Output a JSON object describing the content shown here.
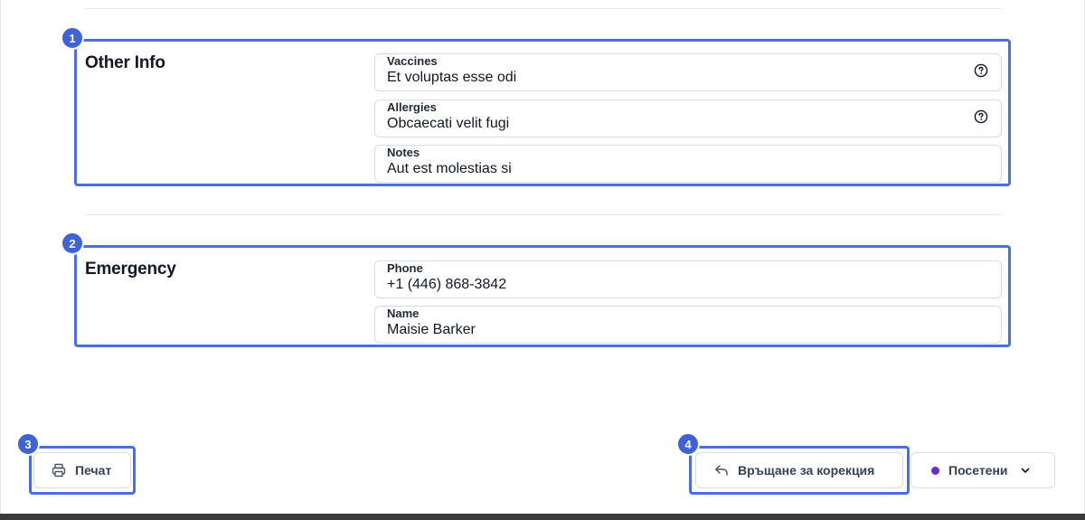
{
  "sections": {
    "other_info": {
      "title": "Other Info",
      "fields": {
        "vaccines": {
          "label": "Vaccines",
          "value": "Et voluptas esse odi",
          "icon": "help-circle-icon"
        },
        "allergies": {
          "label": "Allergies",
          "value": "Obcaecati velit fugi",
          "icon": "help-circle-icon"
        },
        "notes": {
          "label": "Notes",
          "value": "Aut est molestias si"
        }
      }
    },
    "emergency": {
      "title": "Emergency",
      "fields": {
        "phone": {
          "label": "Phone",
          "value": "+1 (446) 868-3842"
        },
        "name": {
          "label": "Name",
          "value": "Maisie Barker"
        }
      }
    }
  },
  "footer": {
    "print_label": "Печат",
    "return_label": "Връщане за корекция",
    "status_label": "Посетени",
    "status_color": "#6d28d9"
  },
  "annotations": {
    "marker_1": "1",
    "marker_2": "2",
    "marker_3": "3",
    "marker_4": "4",
    "color": "#4a6fe0"
  }
}
